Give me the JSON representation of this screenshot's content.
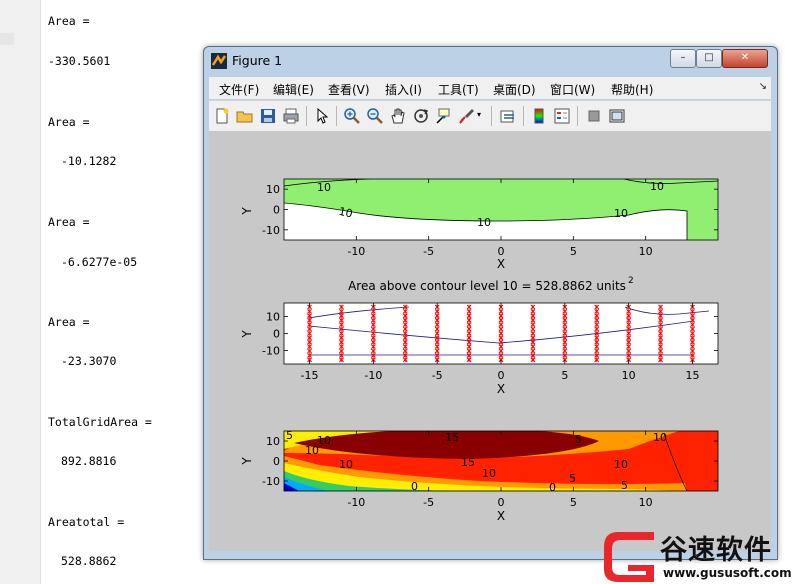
{
  "command_window": {
    "lines": [
      "Area =",
      "-330.5601",
      "Area =",
      "-10.1282",
      "Area =",
      "-6.6277e-05",
      "Area =",
      "-23.3070",
      "TotalGridArea =",
      "892.8816",
      "Areatotal =",
      "528.8862"
    ]
  },
  "figure": {
    "title": "Figure 1",
    "menu": [
      "文件(F)",
      "编辑(E)",
      "查看(V)",
      "插入(I)",
      "工具(T)",
      "桌面(D)",
      "窗口(W)",
      "帮助(H)"
    ],
    "toolbar_icons": [
      "new-file-icon",
      "open-folder-icon",
      "save-icon",
      "print-icon",
      "pointer-icon",
      "zoom-in-icon",
      "zoom-out-icon",
      "pan-hand-icon",
      "rotate-3d-icon",
      "data-cursor-icon",
      "brush-icon",
      "link-plot-icon",
      "colorbar-icon",
      "legend-icon",
      "hide-plot-tools-icon",
      "show-plot-tools-icon"
    ]
  },
  "chart_data": [
    {
      "type": "contour",
      "title": "",
      "xlabel": "X",
      "ylabel": "Y",
      "xlim": [
        -15,
        15
      ],
      "ylim": [
        -15,
        15
      ],
      "x_ticks": [
        -10,
        -5,
        0,
        5,
        10
      ],
      "y_ticks": [
        10,
        0,
        -10
      ],
      "contour_labels": [
        "10",
        "10",
        "10",
        "10"
      ],
      "fill_color": "#90ee70",
      "contour_level": 10
    },
    {
      "type": "scatter",
      "title": "Area above contour level 10 = 528.8862 units",
      "title_superscript": "2",
      "xlabel": "X",
      "ylabel": "Y",
      "xlim": [
        -17,
        17
      ],
      "ylim": [
        -18,
        18
      ],
      "x_ticks": [
        -15,
        -10,
        -5,
        0,
        5,
        10,
        15
      ],
      "y_ticks": [
        10,
        0,
        -10
      ],
      "grid_columns_x": [
        -15,
        -12.5,
        -10,
        -7.5,
        -5,
        -2.5,
        0,
        2.5,
        5,
        7.5,
        10,
        12.5,
        15
      ],
      "marker_color": "#ff0000"
    },
    {
      "type": "heatmap",
      "title": "",
      "xlabel": "X",
      "ylabel": "Y",
      "xlim": [
        -15,
        15
      ],
      "ylim": [
        -15,
        15
      ],
      "x_ticks": [
        -10,
        -5,
        0,
        5,
        10
      ],
      "y_ticks": [
        10,
        0,
        -10
      ],
      "contour_labels": [
        "15",
        "10",
        "15",
        "10",
        "5",
        "10",
        "10",
        "10",
        "5",
        "0",
        "5",
        "0",
        "5",
        "10"
      ]
    }
  ],
  "watermark": {
    "text_cn": "谷速软件",
    "url": "www.gususoft.com",
    "accent_color": "#e8262b"
  }
}
